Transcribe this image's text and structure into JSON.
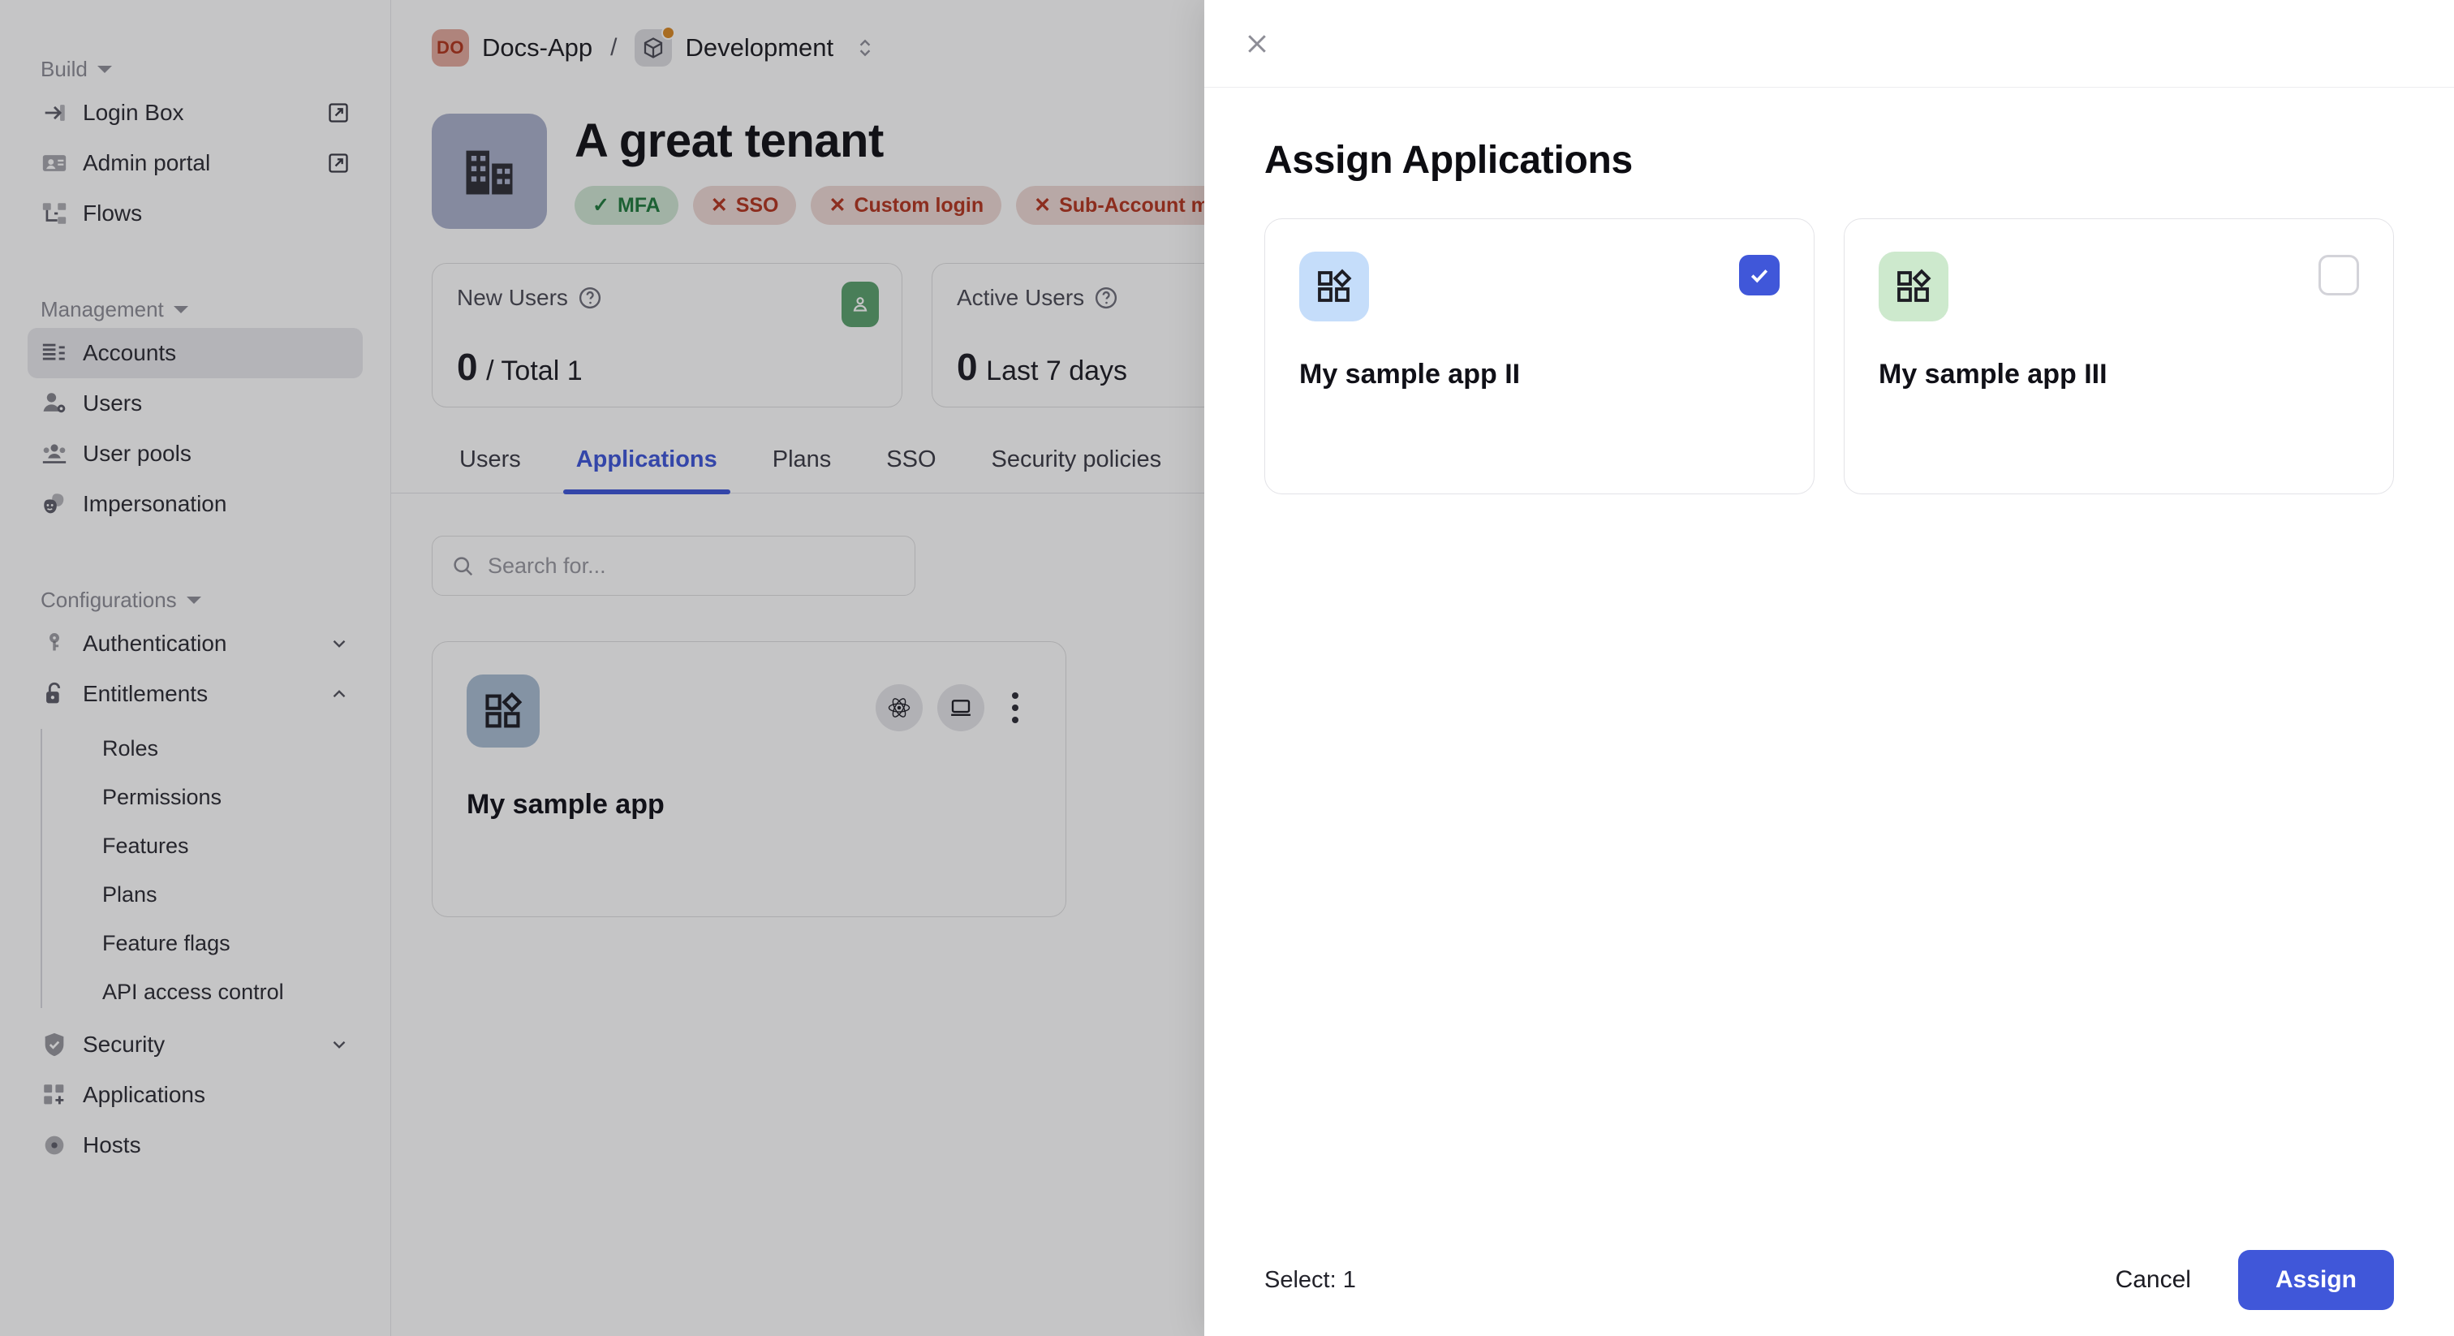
{
  "sidebar": {
    "groups": [
      {
        "label": "Build",
        "items": [
          {
            "label": "Login Box",
            "icon": "login-arrow-icon",
            "external": true
          },
          {
            "label": "Admin portal",
            "icon": "id-card-icon",
            "external": true
          },
          {
            "label": "Flows",
            "icon": "flows-icon",
            "external": false
          }
        ]
      },
      {
        "label": "Management",
        "items": [
          {
            "label": "Accounts",
            "icon": "accounts-list-icon",
            "active": true
          },
          {
            "label": "Users",
            "icon": "user-gear-icon"
          },
          {
            "label": "User pools",
            "icon": "user-group-icon"
          },
          {
            "label": "Impersonation",
            "icon": "masks-icon"
          }
        ]
      },
      {
        "label": "Configurations",
        "items": [
          {
            "label": "Authentication",
            "icon": "key-icon",
            "chevron": "down"
          },
          {
            "label": "Entitlements",
            "icon": "unlock-icon",
            "chevron": "up",
            "children": [
              "Roles",
              "Permissions",
              "Features",
              "Plans",
              "Feature flags",
              "API access control"
            ]
          },
          {
            "label": "Security",
            "icon": "shield-check-icon",
            "chevron": "down"
          },
          {
            "label": "Applications",
            "icon": "apps-plus-icon"
          },
          {
            "label": "Hosts",
            "icon": "host-icon"
          }
        ]
      }
    ]
  },
  "breadcrumb": {
    "avatar_initials": "DO",
    "project": "Docs-App",
    "separator": "/",
    "environment": "Development"
  },
  "tenant": {
    "name": "A great tenant",
    "badges": [
      {
        "label": "MFA",
        "state": "ok",
        "mark": "✓"
      },
      {
        "label": "SSO",
        "state": "no",
        "mark": "✕"
      },
      {
        "label": "Custom login",
        "state": "no",
        "mark": "✕"
      },
      {
        "label": "Sub-Account management",
        "state": "no",
        "mark": "✕"
      }
    ]
  },
  "stats": [
    {
      "label": "New Users",
      "value": "0",
      "suffix": "/ Total 1",
      "has_pill": true
    },
    {
      "label": "Active Users",
      "value": "0",
      "suffix": "Last 7 days",
      "has_pill": false
    }
  ],
  "tabs": [
    {
      "label": "Users",
      "active": false
    },
    {
      "label": "Applications",
      "active": true
    },
    {
      "label": "Plans",
      "active": false
    },
    {
      "label": "SSO",
      "active": false
    },
    {
      "label": "Security policies",
      "active": false
    }
  ],
  "search": {
    "placeholder": "Search for..."
  },
  "app_list": [
    {
      "name": "My sample app",
      "icon_color": "#a9bcd2",
      "actions": [
        "react-icon",
        "laptop-icon",
        "kebab-menu-icon"
      ]
    }
  ],
  "drawer": {
    "title": "Assign Applications",
    "close_label": "×",
    "cards": [
      {
        "name": "My sample app II",
        "icon_bg": "#c5ddfa",
        "selected": true
      },
      {
        "name": "My sample app III",
        "icon_bg": "#cde9cd",
        "selected": false
      }
    ],
    "select_count_label": "Select: 1",
    "cancel_label": "Cancel",
    "assign_label": "Assign"
  },
  "colors": {
    "accent": "#4057d9",
    "tab_active": "#3e56d8",
    "badge_ok": "#1f7a3d",
    "badge_no": "#b3341f"
  }
}
